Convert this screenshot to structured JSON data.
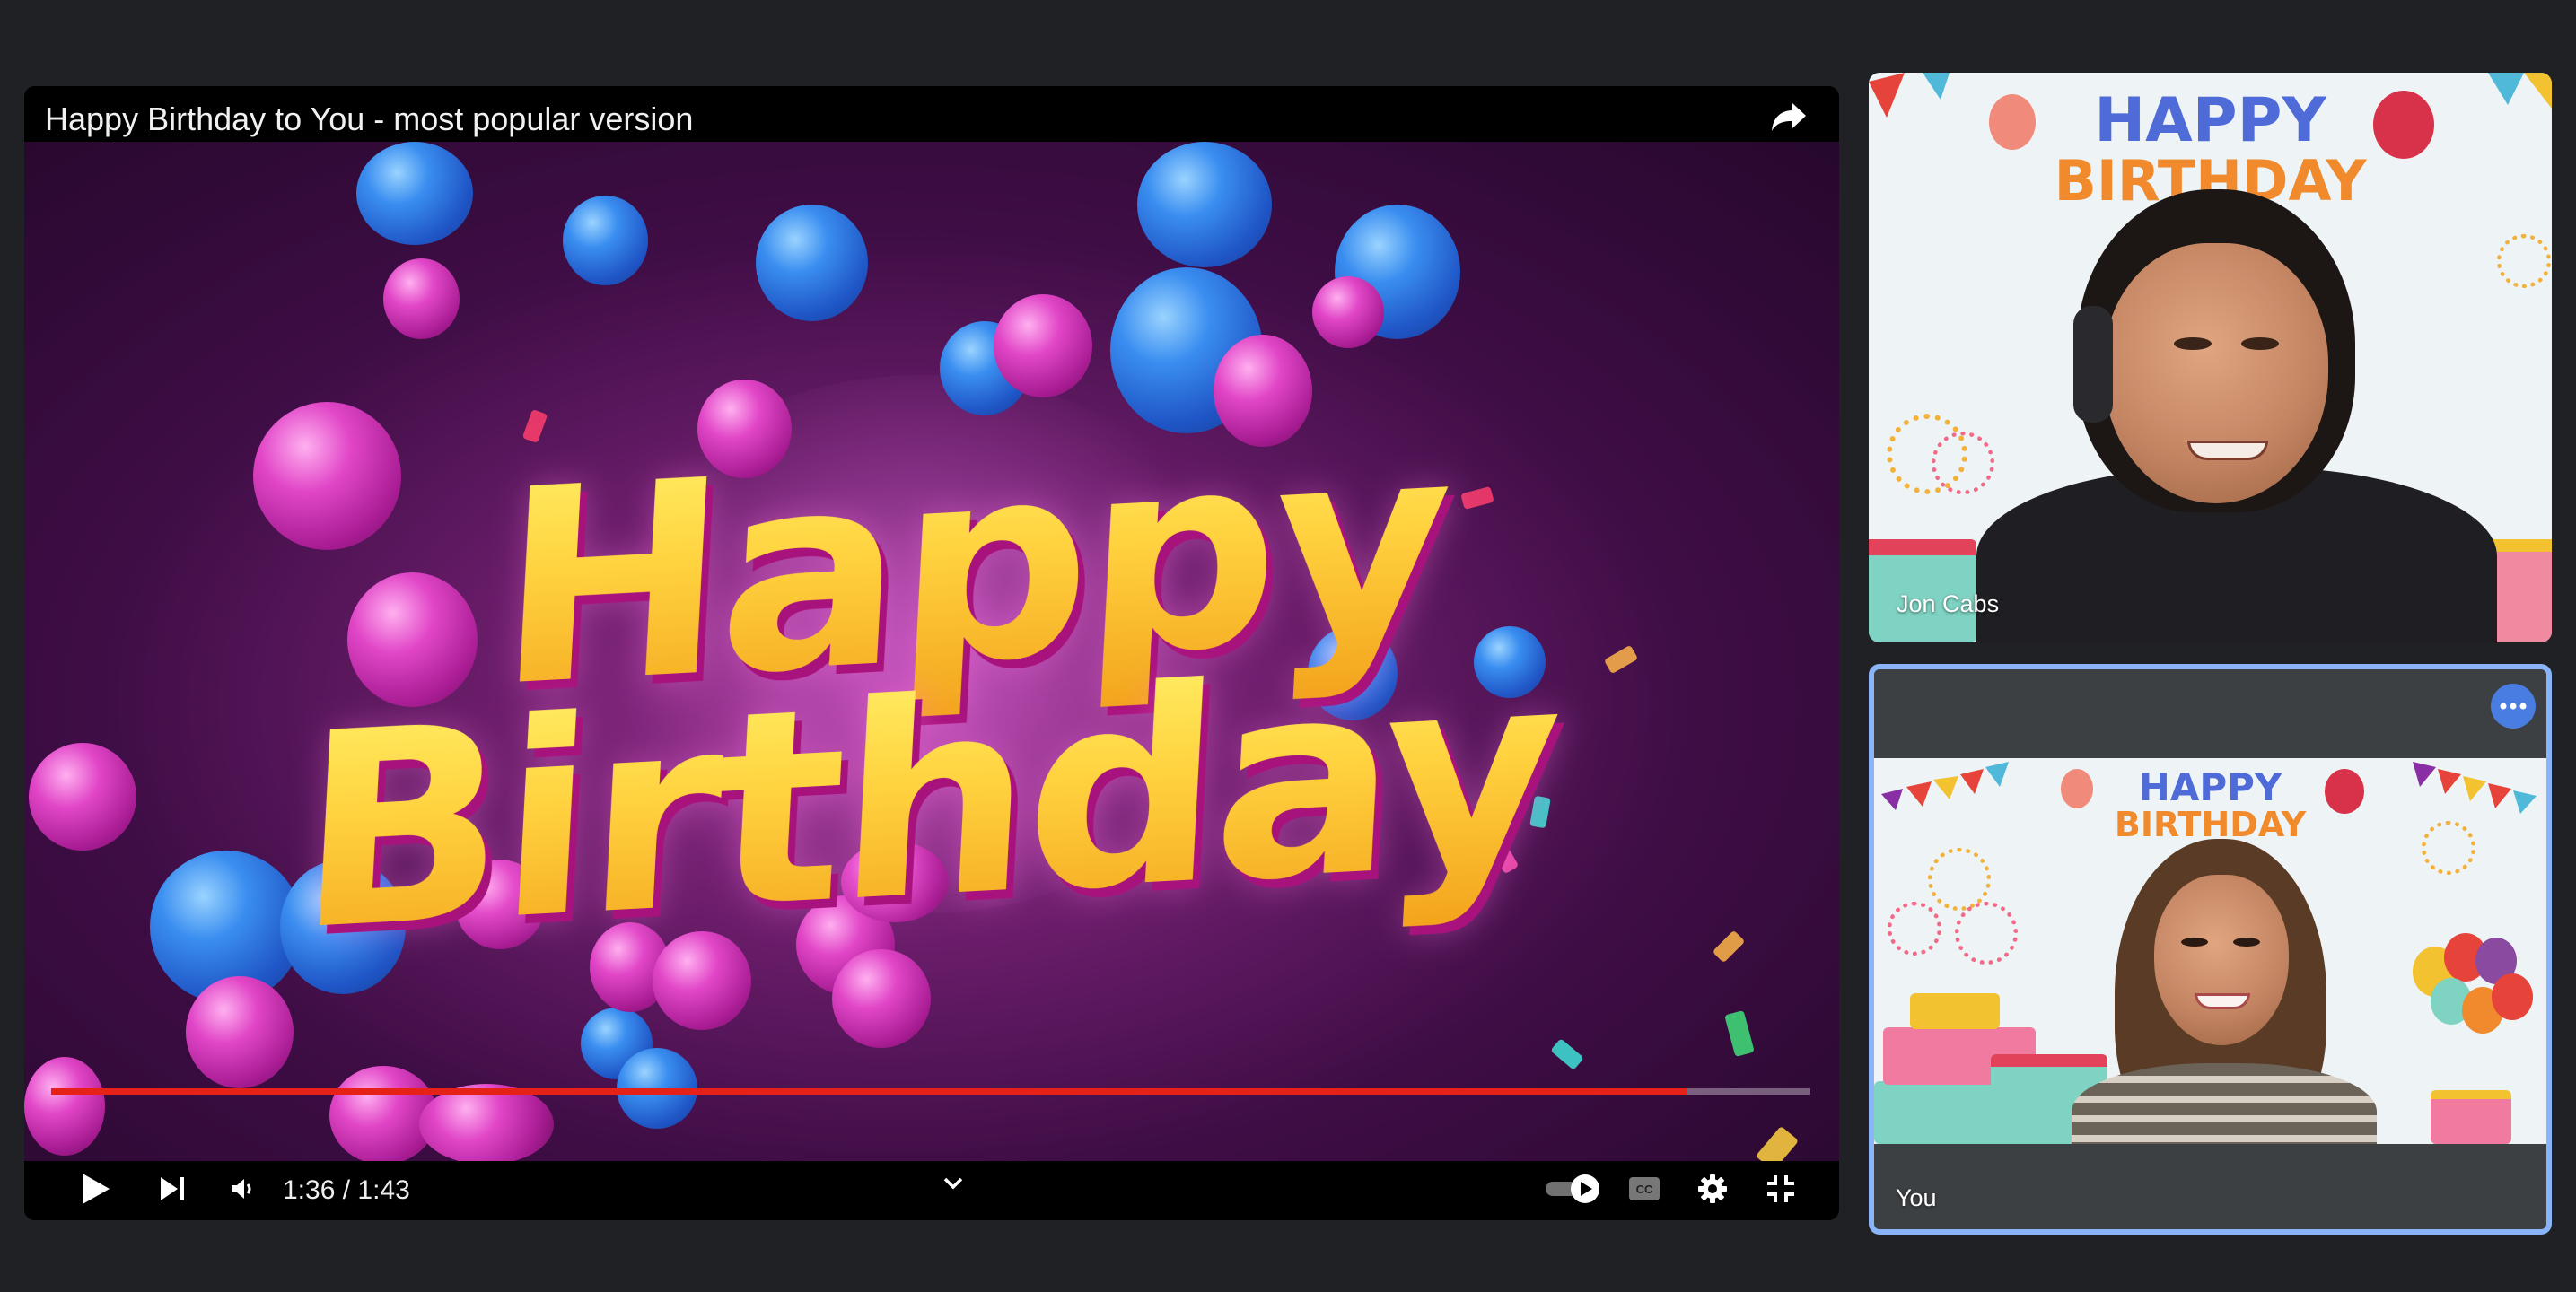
{
  "player": {
    "title": "Happy Birthday to You - most popular version",
    "headline_line1": "Happy",
    "headline_line2": "Birthday",
    "time_display": "1:36 / 1:43",
    "progress_fraction": 0.93,
    "icons": {
      "share": "share-icon",
      "play": "play-icon",
      "next": "next-icon",
      "volume": "volume-icon",
      "chevron": "chevron-down-icon",
      "autoplay": "autoplay-toggle-icon",
      "captions": "captions-icon",
      "settings": "gear-icon",
      "fullscreen_exit": "exit-fullscreen-icon"
    }
  },
  "participants": [
    {
      "name": "Jon Cabs",
      "background_text_line1": "HAPPY",
      "background_text_line2": "BIRTHDAY"
    },
    {
      "name": "You",
      "background_text_line1": "HAPPY",
      "background_text_line2": "BIRTHDAY",
      "more_icon": "more-options-icon"
    }
  ],
  "colors": {
    "page_background": "#202124",
    "progress_played": "#e62117",
    "active_tile_border": "#8ab4f8",
    "more_button": "#4a7de2"
  }
}
